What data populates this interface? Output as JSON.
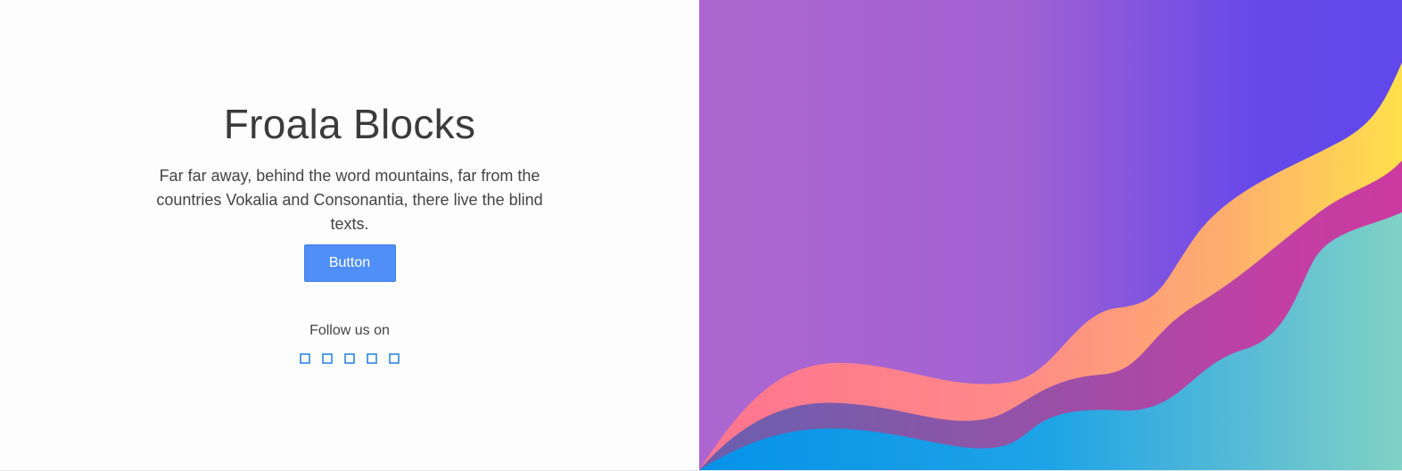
{
  "hero": {
    "title": "Froala Blocks",
    "description": "Far far away, behind the word mountains, far from the countries Vokalia and Consonantia, there live the blind texts.",
    "button_label": "Button"
  },
  "social": {
    "label": "Follow us on",
    "icons": [
      "social-icon-1",
      "social-icon-2",
      "social-icon-3",
      "social-icon-4",
      "social-icon-5"
    ]
  },
  "colors": {
    "button": "#4f8ff7",
    "icon_outline": "#1e7fe0",
    "text": "#3b3b3b",
    "wave_purple_start": "#ad66cf",
    "wave_purple_end": "#6048ea",
    "wave_pink": "#ff7a8f",
    "wave_yellow": "#ffde4a",
    "wave_magenta": "#cc3aa0",
    "wave_blue": "#0796ea",
    "wave_teal": "#7dd1c6"
  }
}
